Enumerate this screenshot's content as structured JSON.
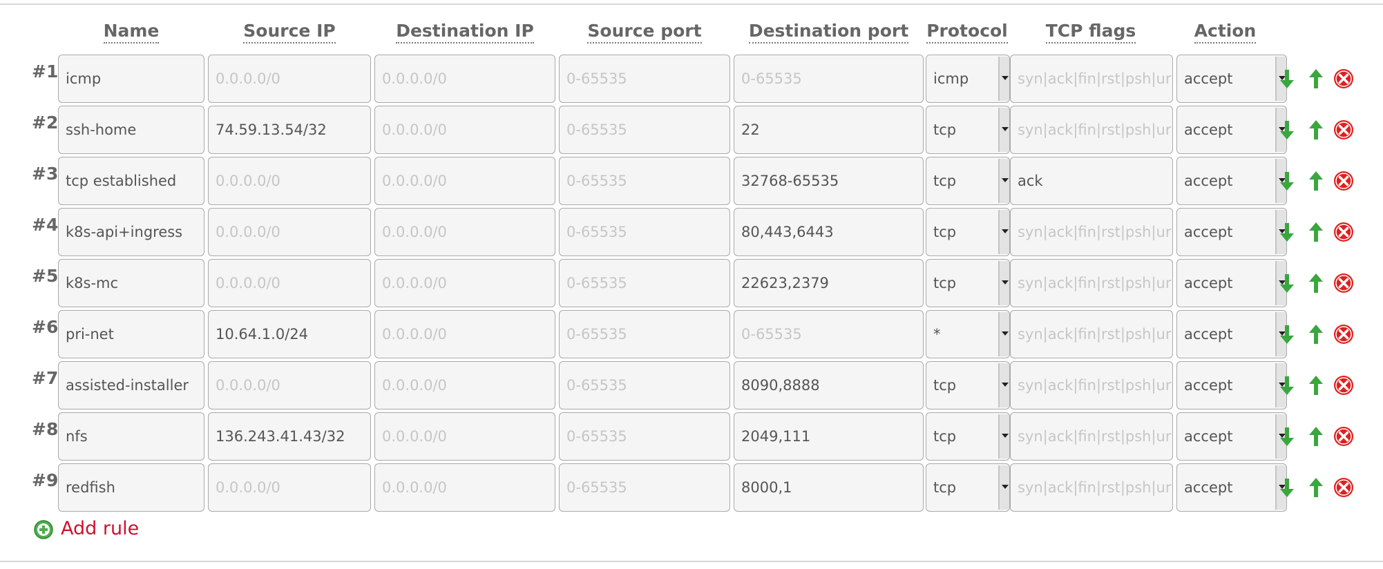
{
  "columns": {
    "name": "Name",
    "source_ip": "Source IP",
    "destination_ip": "Destination IP",
    "source_port": "Source port",
    "destination_port": "Destination port",
    "protocol": "Protocol",
    "tcp_flags": "TCP flags",
    "action": "Action"
  },
  "placeholders": {
    "source_ip": "0.0.0.0/0",
    "destination_ip": "0.0.0.0/0",
    "source_port": "0-65535",
    "destination_port": "0-65535",
    "tcp_flags": "syn|ack|fin|rst|psh|ur"
  },
  "rules": [
    {
      "number": "#1",
      "name": "icmp",
      "source_ip": "",
      "destination_ip": "",
      "source_port": "",
      "destination_port": "",
      "protocol": "icmp",
      "tcp_flags": "",
      "action": "accept"
    },
    {
      "number": "#2",
      "name": "ssh-home",
      "source_ip": "74.59.13.54/32",
      "destination_ip": "",
      "source_port": "",
      "destination_port": "22",
      "protocol": "tcp",
      "tcp_flags": "",
      "action": "accept"
    },
    {
      "number": "#3",
      "name": "tcp established",
      "source_ip": "",
      "destination_ip": "",
      "source_port": "",
      "destination_port": "32768-65535",
      "protocol": "tcp",
      "tcp_flags": "ack",
      "action": "accept"
    },
    {
      "number": "#4",
      "name": "k8s-api+ingress",
      "source_ip": "",
      "destination_ip": "",
      "source_port": "",
      "destination_port": "80,443,6443",
      "protocol": "tcp",
      "tcp_flags": "",
      "action": "accept"
    },
    {
      "number": "#5",
      "name": "k8s-mc",
      "source_ip": "",
      "destination_ip": "",
      "source_port": "",
      "destination_port": "22623,2379",
      "protocol": "tcp",
      "tcp_flags": "",
      "action": "accept"
    },
    {
      "number": "#6",
      "name": "pri-net",
      "source_ip": "10.64.1.0/24",
      "destination_ip": "",
      "source_port": "",
      "destination_port": "",
      "protocol": "*",
      "tcp_flags": "",
      "action": "accept"
    },
    {
      "number": "#7",
      "name": "assisted-installer",
      "source_ip": "",
      "destination_ip": "",
      "source_port": "",
      "destination_port": "8090,8888",
      "protocol": "tcp",
      "tcp_flags": "",
      "action": "accept"
    },
    {
      "number": "#8",
      "name": "nfs",
      "source_ip": "136.243.41.43/32",
      "destination_ip": "",
      "source_port": "",
      "destination_port": "2049,111",
      "protocol": "tcp",
      "tcp_flags": "",
      "action": "accept"
    },
    {
      "number": "#9",
      "name": "redfish",
      "source_ip": "",
      "destination_ip": "",
      "source_port": "",
      "destination_port": "8000,1",
      "protocol": "tcp",
      "tcp_flags": "",
      "action": "accept"
    }
  ],
  "row_icons": [
    "arrow-down-icon",
    "arrow-up-icon",
    "delete-icon"
  ],
  "add_rule": {
    "label": "Add rule",
    "icon": "plus-circle-icon"
  },
  "colors": {
    "arrow_green": "#3aa63e",
    "delete_red": "#e02020",
    "add_rule_text": "#d0102f",
    "field_bg": "#f5f5f5",
    "placeholder_text": "#c6c6c6"
  }
}
